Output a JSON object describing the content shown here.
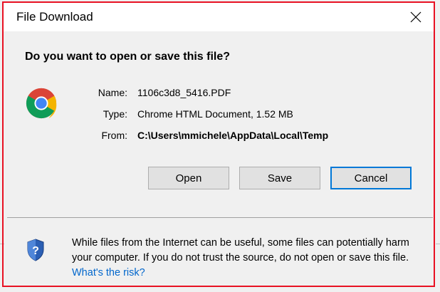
{
  "window": {
    "title": "File Download",
    "close_icon": "close-icon"
  },
  "prompt": {
    "question": "Do you want to open or save this file?"
  },
  "file": {
    "icon": "chrome-icon",
    "name_label": "Name:",
    "name_value": "1106c3d8_5416.PDF",
    "type_label": "Type:",
    "type_value": "Chrome HTML Document, 1.52 MB",
    "from_label": "From:",
    "from_value": "C:\\Users\\mmichele\\AppData\\Local\\Temp"
  },
  "buttons": {
    "open_label": "Open",
    "save_label": "Save",
    "cancel_label": "Cancel"
  },
  "warning": {
    "icon": "shield-icon",
    "text": "While files from the Internet can be useful, some files can potentially harm your computer. If you do not trust the source, do not open or save this file. ",
    "link_label": "What's the risk?"
  },
  "colors": {
    "dialog_bg": "#f0f0f0",
    "title_bg": "#ffffff",
    "frame_highlight": "#e81123",
    "default_button_border": "#0078d7",
    "link": "#0066cc"
  }
}
